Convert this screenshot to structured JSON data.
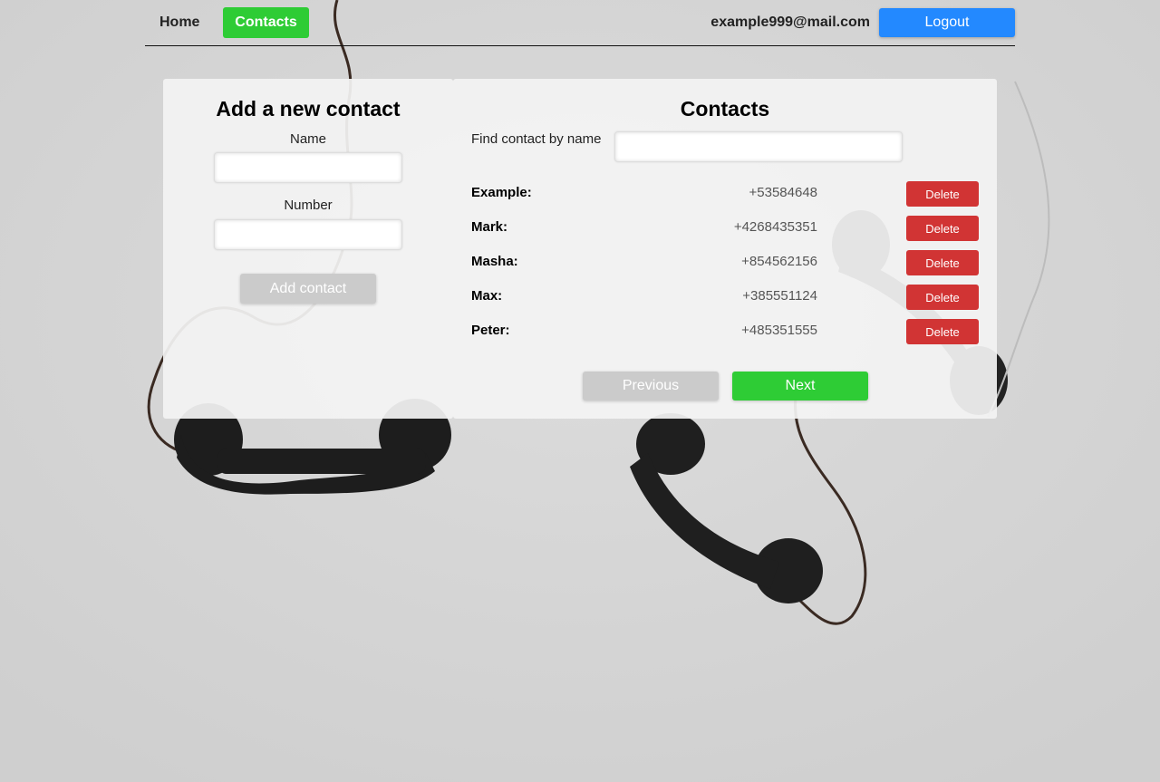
{
  "nav": {
    "home_label": "Home",
    "contacts_label": "Contacts"
  },
  "user": {
    "email": "example999@mail.com",
    "logout_label": "Logout"
  },
  "add_form": {
    "title": "Add a new contact",
    "name_label": "Name",
    "name_value": "",
    "number_label": "Number",
    "number_value": "",
    "submit_label": "Add contact"
  },
  "contacts_panel": {
    "title": "Contacts",
    "filter_label": "Find contact by name",
    "filter_value": "",
    "contacts": [
      {
        "name": "Example:",
        "number": "+53584648",
        "delete_label": "Delete"
      },
      {
        "name": "Mark:",
        "number": "+4268435351",
        "delete_label": "Delete"
      },
      {
        "name": "Masha:",
        "number": "+854562156",
        "delete_label": "Delete"
      },
      {
        "name": "Max:",
        "number": "+385551124",
        "delete_label": "Delete"
      },
      {
        "name": "Peter:",
        "number": "+485351555",
        "delete_label": "Delete"
      }
    ],
    "prev_label": "Previous",
    "next_label": "Next"
  },
  "colors": {
    "active_nav": "#2ecc35",
    "logout": "#2389ff",
    "delete": "#d13434",
    "next": "#2ecc35",
    "disabled": "#cbcbcb"
  },
  "background": {
    "image": "vintage-telephone-handsets-icon"
  }
}
